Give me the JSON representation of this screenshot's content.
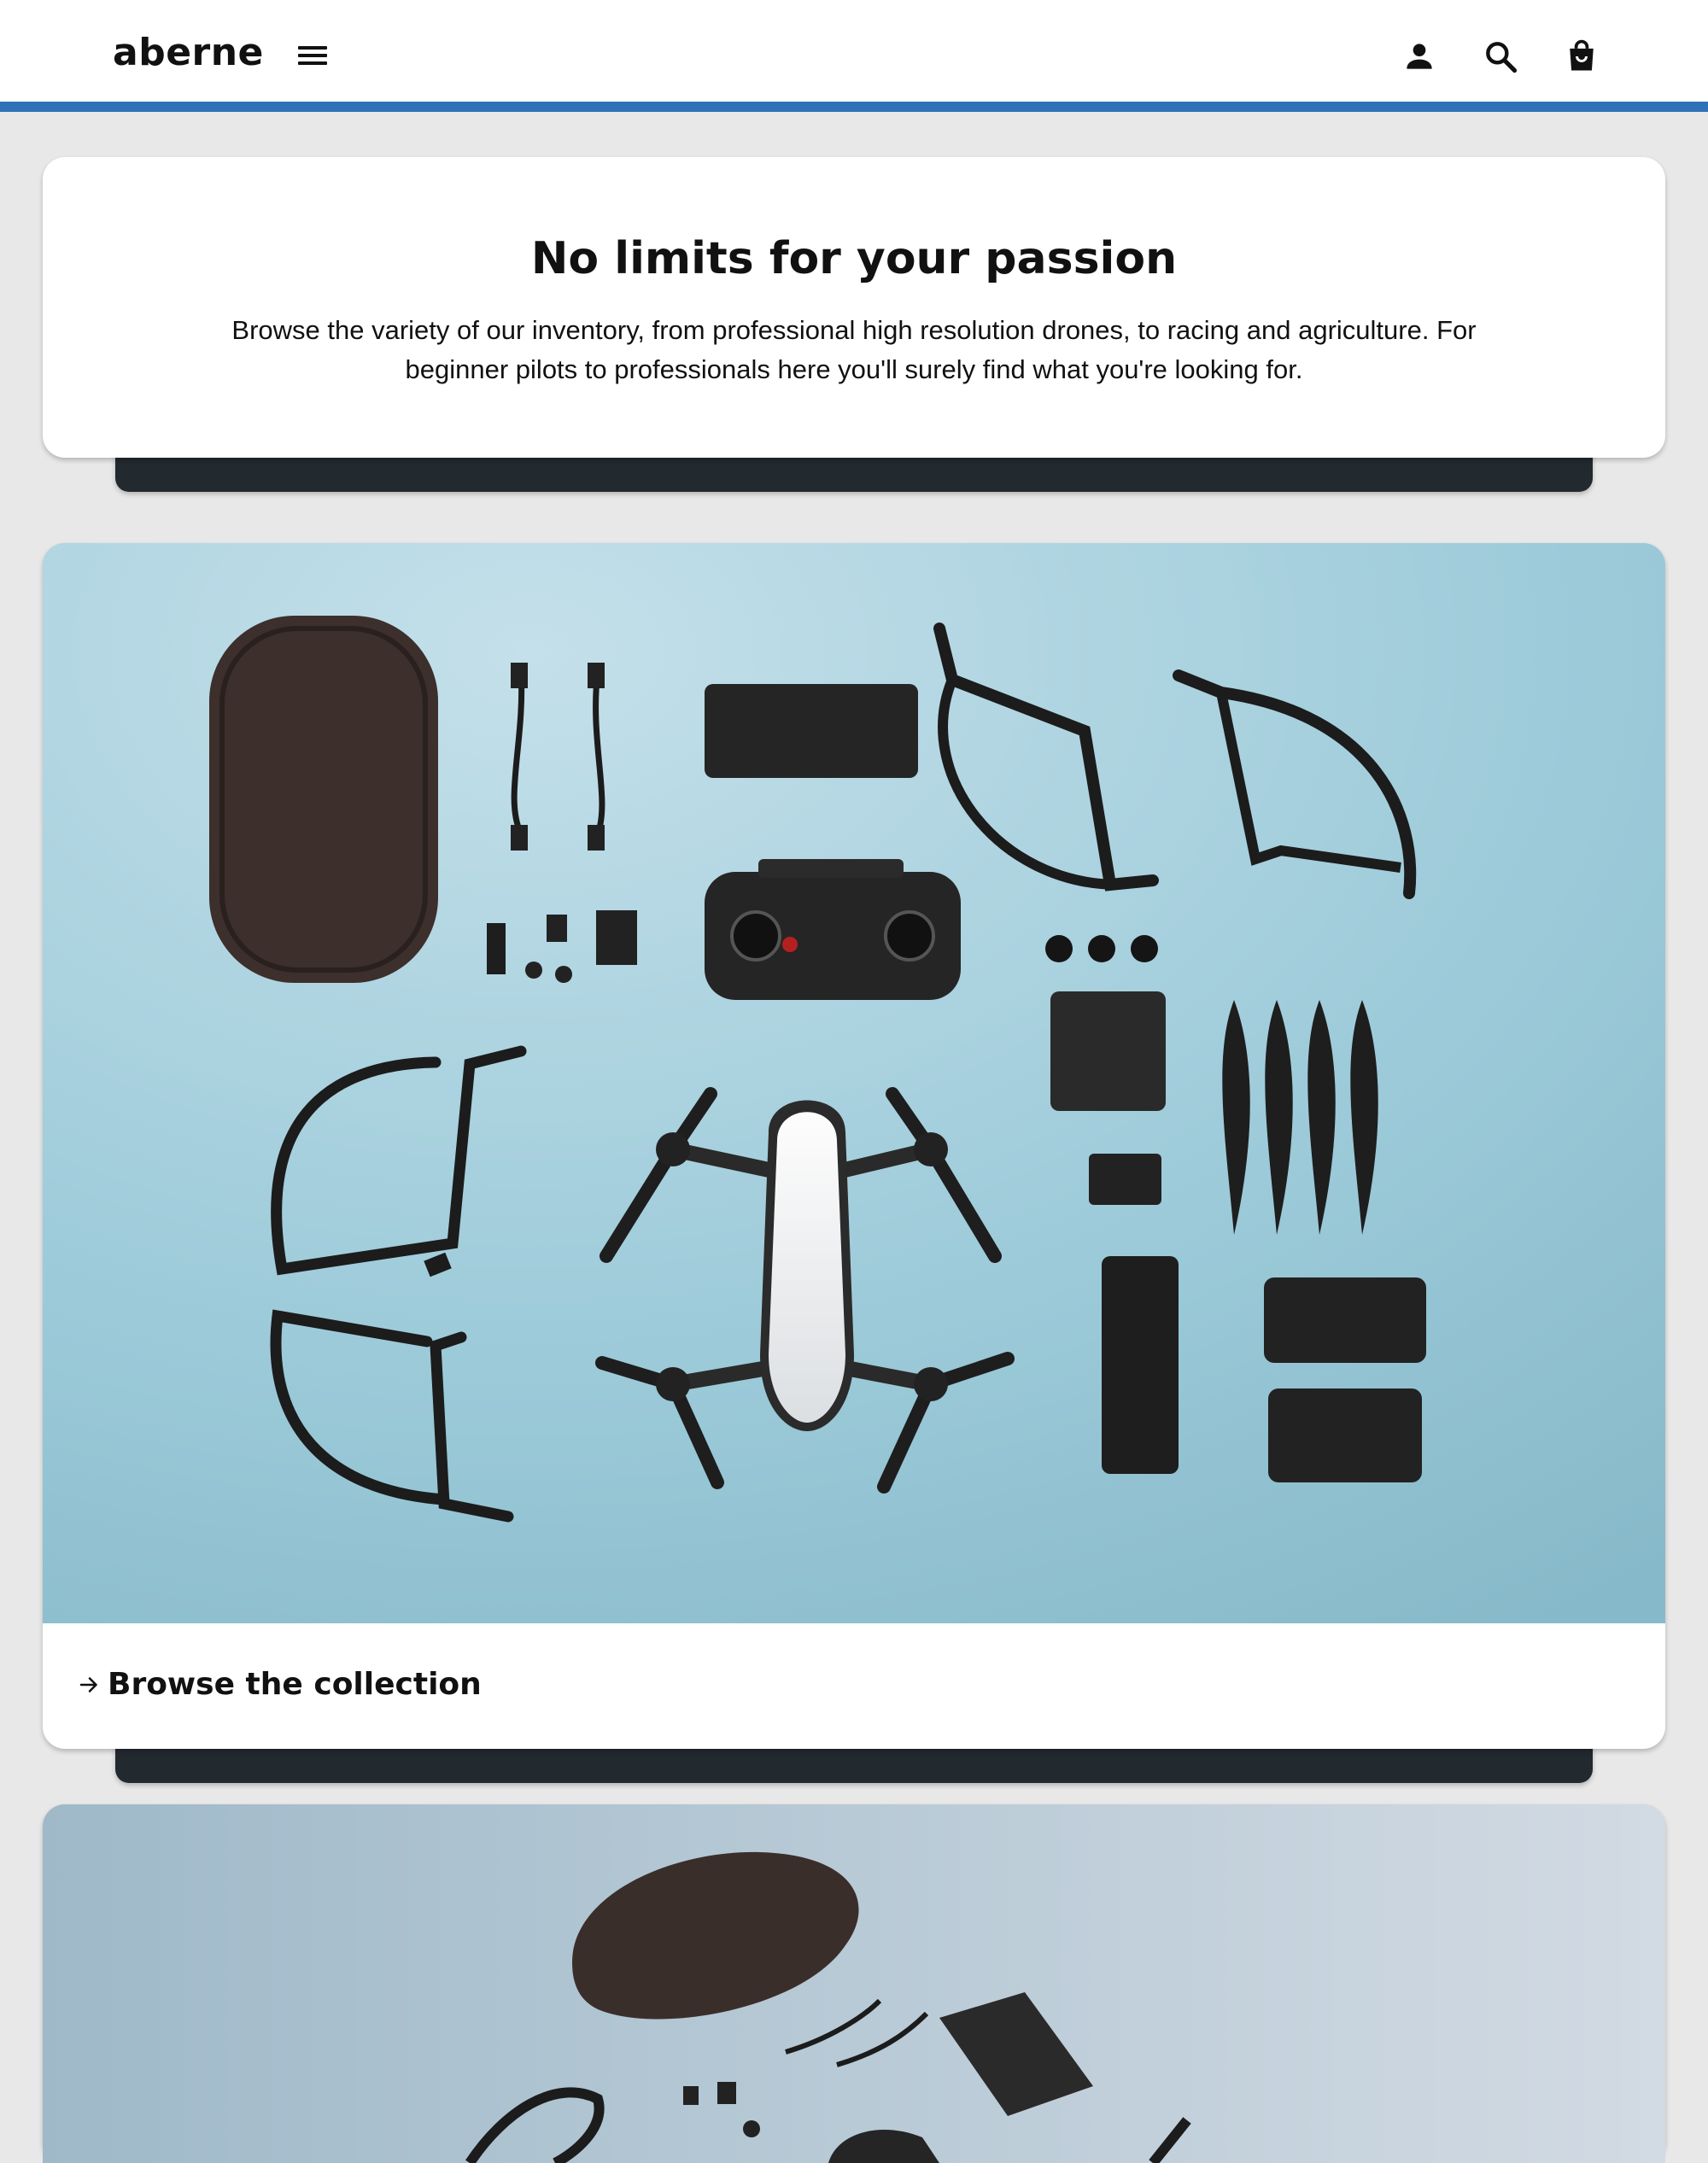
{
  "header": {
    "brand": "aberne",
    "icons": [
      "menu-icon",
      "account-icon",
      "search-icon",
      "cart-icon"
    ]
  },
  "hero": {
    "title": "No limits for your passion",
    "text": "Browse the variety of our inventory, from professional high resolution drones, to racing and agriculture. For beginner pilots to professionals here you'll surely find what you're looking for."
  },
  "collection": {
    "link_label": "Browse the collection",
    "link_icon": "arrow-right-icon",
    "image": "drone-kit-flatlay-photo"
  },
  "second_card": {
    "image": "drone-kit-angled-photo"
  },
  "colors": {
    "accent": "#2f72b8",
    "page_background": "#e8e8e8",
    "card_background": "#ffffff",
    "card_bar": "#22292f",
    "photo_background": "#9ec8d6"
  }
}
